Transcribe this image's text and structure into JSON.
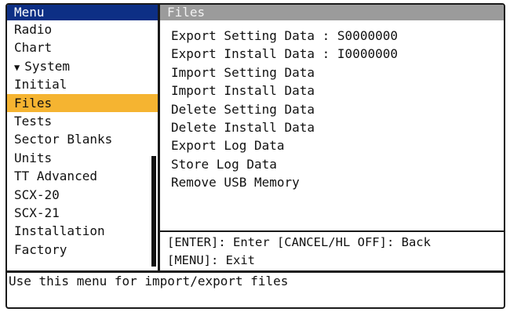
{
  "menu": {
    "header": "Menu",
    "items": [
      {
        "label": "Radio",
        "arrow": ""
      },
      {
        "label": "Chart",
        "arrow": ""
      },
      {
        "label": "System",
        "arrow": "▼"
      },
      {
        "label": "Initial",
        "arrow": ""
      },
      {
        "label": "Files",
        "arrow": "",
        "selected": true
      },
      {
        "label": "Tests",
        "arrow": ""
      },
      {
        "label": "Sector Blanks",
        "arrow": ""
      },
      {
        "label": "Units",
        "arrow": ""
      },
      {
        "label": "TT Advanced",
        "arrow": ""
      },
      {
        "label": "SCX-20",
        "arrow": ""
      },
      {
        "label": "SCX-21",
        "arrow": ""
      },
      {
        "label": "Installation",
        "arrow": ""
      },
      {
        "label": "Factory",
        "arrow": ""
      }
    ],
    "selected_color": "#f5b431"
  },
  "files": {
    "header": "Files",
    "items": [
      "Export Setting Data : S0000000",
      "Export Install Data : I0000000",
      "Import Setting Data",
      "Import Install Data",
      "Delete Setting Data",
      "Delete Install Data",
      "Export Log Data",
      "Store Log Data",
      "Remove USB Memory"
    ]
  },
  "hints": {
    "line1": "[ENTER]: Enter [CANCEL/HL OFF]: Back",
    "line2": "[MENU]: Exit"
  },
  "status": {
    "text": "Use this menu for import/export files"
  },
  "colors": {
    "menu_header_bg": "#0d2f85",
    "files_header_bg": "#9b9b9b"
  }
}
